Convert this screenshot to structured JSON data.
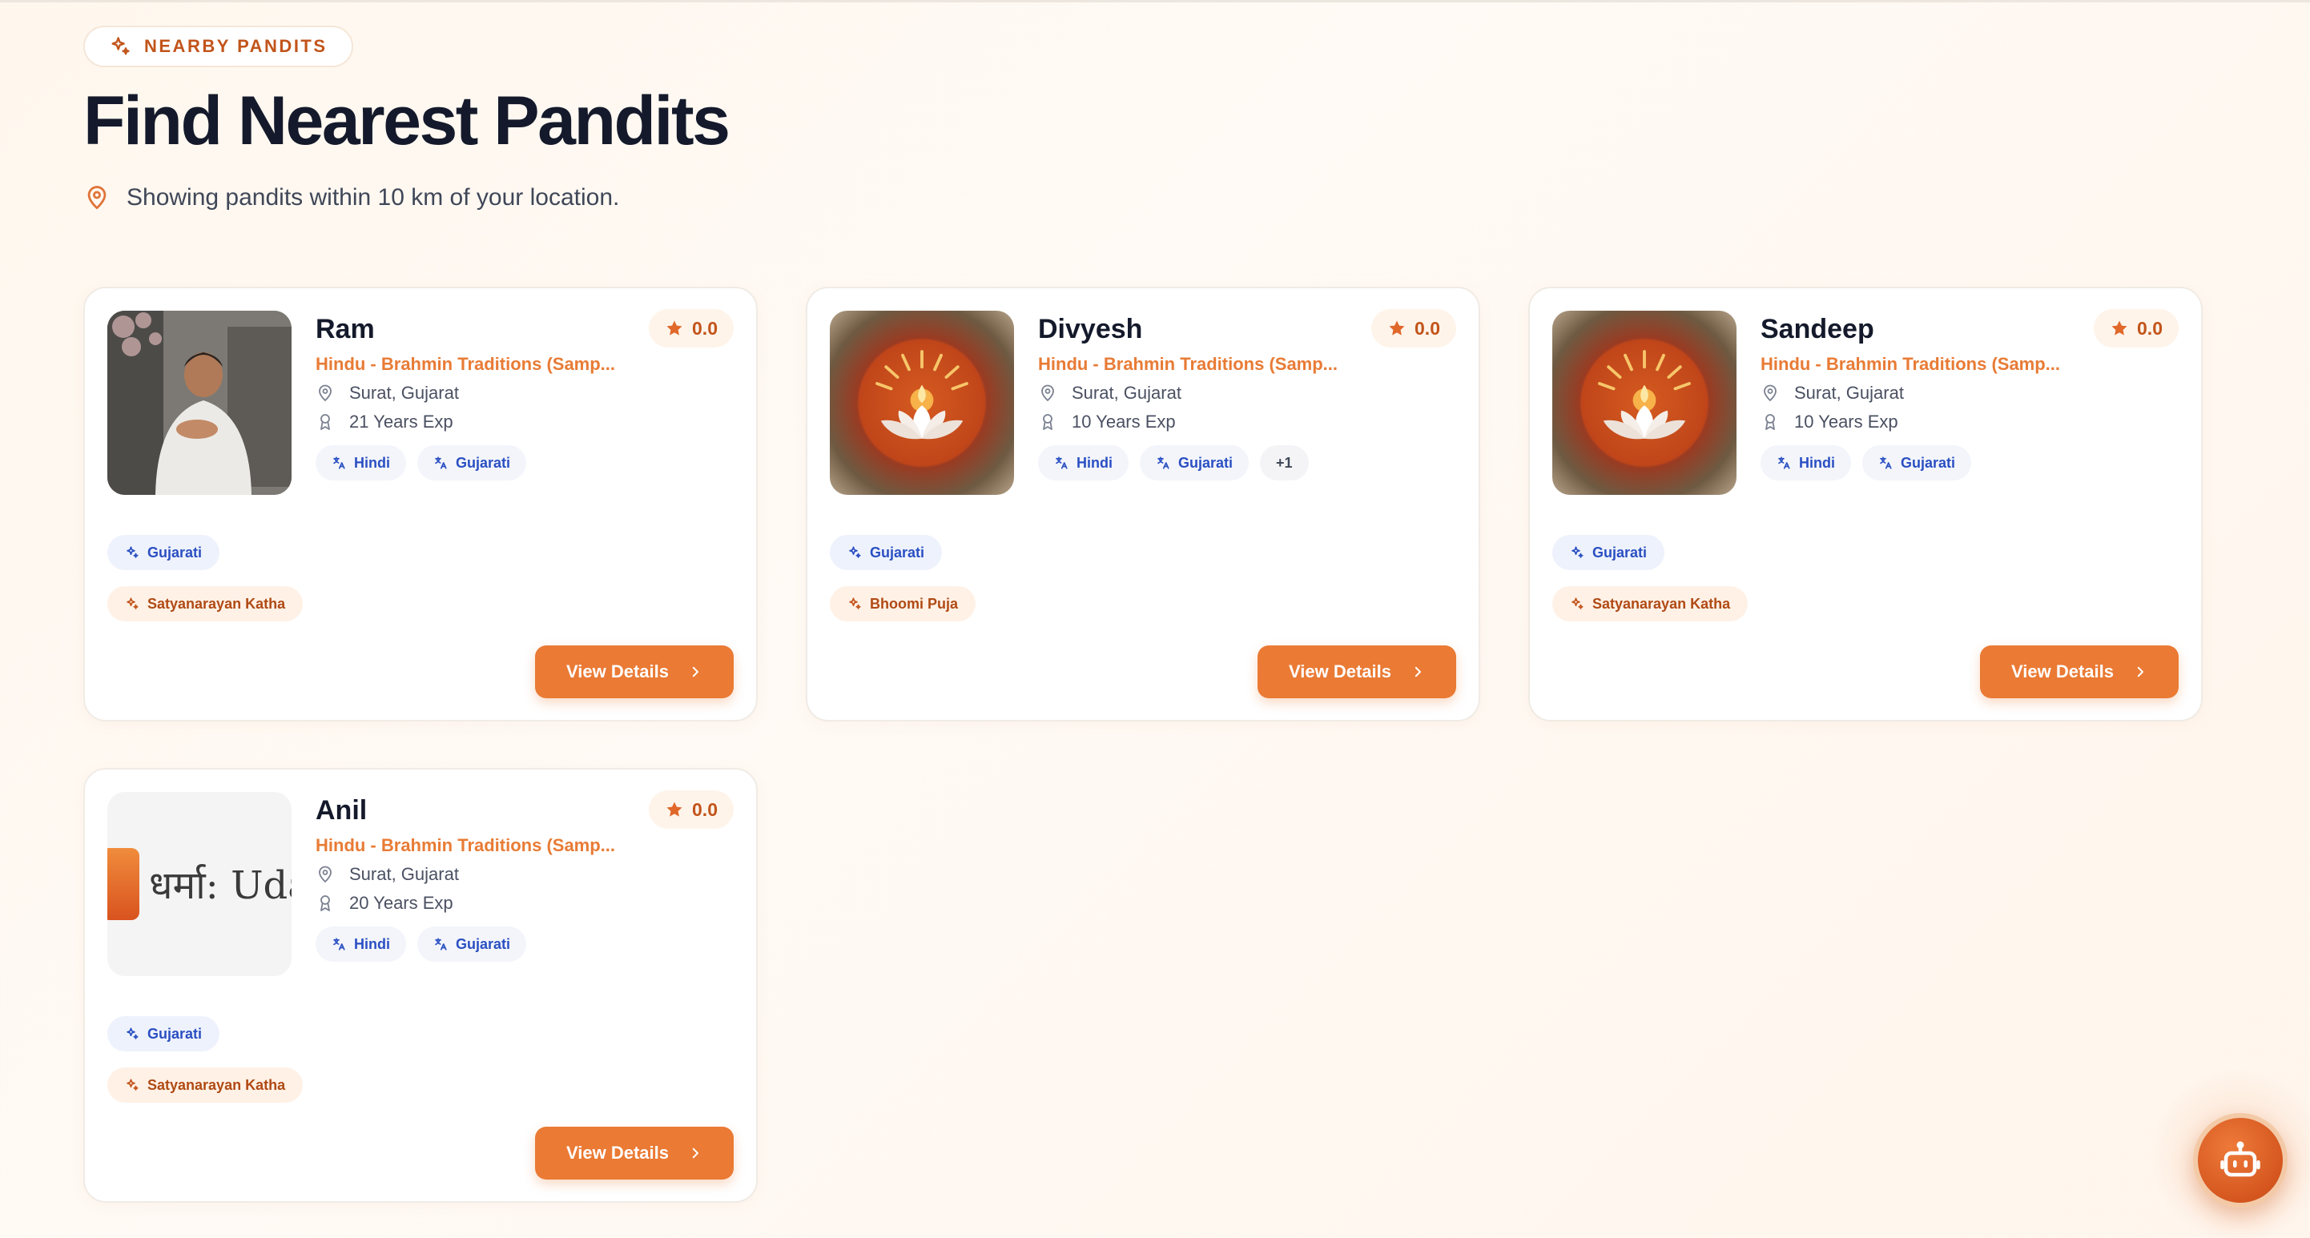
{
  "header": {
    "badge_label": "NEARBY PANDITS",
    "title": "Find Nearest Pandits",
    "subtitle": "Showing pandits within 10 km of your location."
  },
  "cards": [
    {
      "name": "Ram",
      "tradition": "Hindu - Brahmin Traditions (Samp...",
      "location": "Surat, Gujarat",
      "experience": "21 Years Exp",
      "rating": "0.0",
      "languages": [
        "Hindi",
        "Gujarati"
      ],
      "extra_languages": "",
      "language_tag": "Gujarati",
      "service": "Satyanarayan Katha",
      "button_label": "View Details",
      "avatar_type": "photo"
    },
    {
      "name": "Divyesh",
      "tradition": "Hindu - Brahmin Traditions (Samp...",
      "location": "Surat, Gujarat",
      "experience": "10 Years Exp",
      "rating": "0.0",
      "languages": [
        "Hindi",
        "Gujarati"
      ],
      "extra_languages": "+1",
      "language_tag": "Gujarati",
      "service": "Bhoomi Puja",
      "button_label": "View Details",
      "avatar_type": "lotus"
    },
    {
      "name": "Sandeep",
      "tradition": "Hindu - Brahmin Traditions (Samp...",
      "location": "Surat, Gujarat",
      "experience": "10 Years Exp",
      "rating": "0.0",
      "languages": [
        "Hindi",
        "Gujarati"
      ],
      "extra_languages": "",
      "language_tag": "Gujarati",
      "service": "Satyanarayan Katha",
      "button_label": "View Details",
      "avatar_type": "lotus"
    },
    {
      "name": "Anil",
      "tradition": "Hindu - Brahmin Traditions (Samp...",
      "location": "Surat, Gujarat",
      "experience": "20 Years Exp",
      "rating": "0.0",
      "languages": [
        "Hindi",
        "Gujarati"
      ],
      "extra_languages": "",
      "language_tag": "Gujarati",
      "service": "Satyanarayan Katha",
      "button_label": "View Details",
      "avatar_type": "logo",
      "avatar_logo_text": "धर्मा: Uda"
    }
  ],
  "chatbot": {
    "icon": "robot-icon"
  },
  "colors": {
    "accent": "#ea7a34",
    "accent_text": "#e87b35",
    "title": "#141a2b",
    "language_chip": "#2a4fc2"
  },
  "icons": {
    "badge": "sparkles-icon",
    "subtitle": "map-pin-icon",
    "rating": "star-icon",
    "location": "map-pin-icon",
    "experience": "award-icon",
    "language": "translate-icon",
    "service": "sparkles-icon",
    "button": "chevron-right-icon"
  }
}
